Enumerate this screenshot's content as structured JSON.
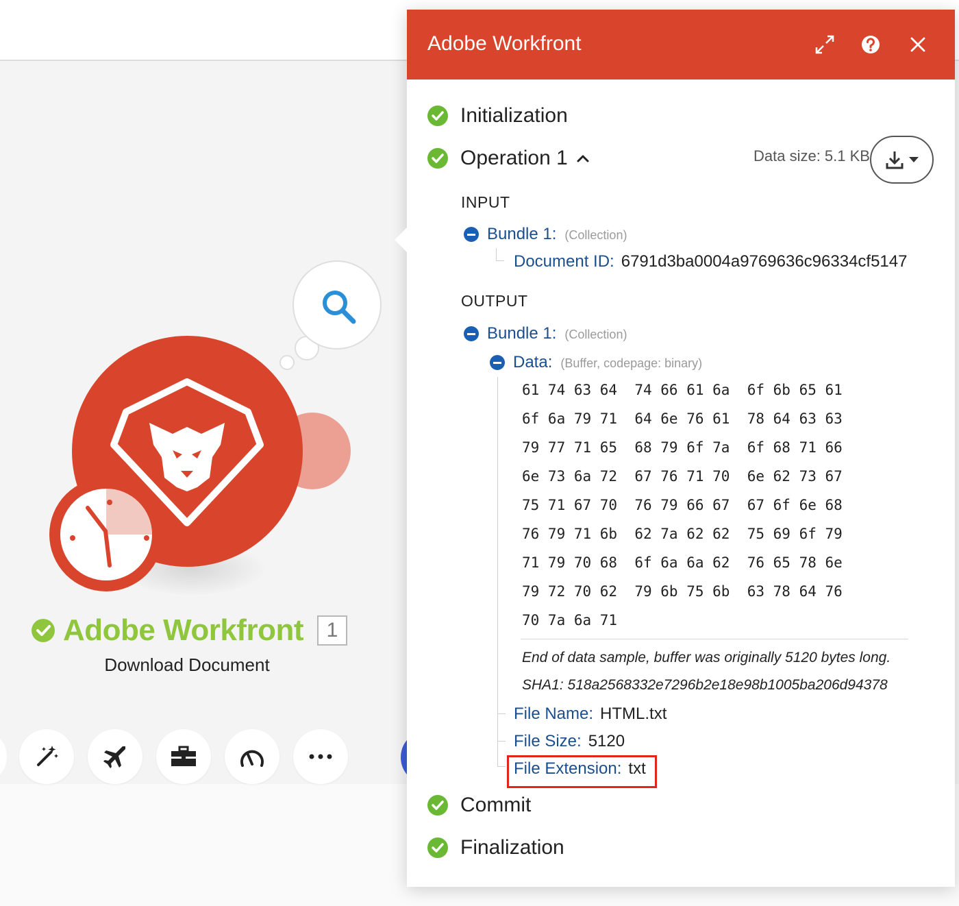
{
  "module": {
    "title": "Adobe Workfront",
    "subtitle": "Download Document",
    "badge": "1"
  },
  "toolbar": {
    "buttons": [
      {
        "name": "magic-wand-icon",
        "glyph": "✨"
      },
      {
        "name": "airplane-icon",
        "glyph": "✈"
      },
      {
        "name": "toolbox-icon",
        "glyph": "🧰"
      },
      {
        "name": "gauge-icon",
        "glyph": "◠"
      },
      {
        "name": "more-icon",
        "glyph": "•••"
      }
    ]
  },
  "panel": {
    "title": "Adobe Workfront",
    "stages": {
      "initialization": "Initialization",
      "operation": "Operation 1",
      "commit": "Commit",
      "finalization": "Finalization"
    },
    "data_size": "Data size: 5.1 KB",
    "input": {
      "heading": "INPUT",
      "bundle_label": "Bundle 1:",
      "bundle_type": "(Collection)",
      "fields": [
        {
          "key": "Document ID:",
          "value": "6791d3ba0004a9769636c96334cf5147"
        }
      ]
    },
    "output": {
      "heading": "OUTPUT",
      "bundle_label": "Bundle 1:",
      "bundle_type": "(Collection)",
      "data_label": "Data:",
      "data_type": "(Buffer, codepage: binary)",
      "hex_lines": [
        "61 74 63 64  74 66 61 6a  6f 6b 65 61",
        "6f 6a 79 71  64 6e 76 61  78 64 63 63",
        "79 77 71 65  68 79 6f 7a  6f 68 71 66",
        "6e 73 6a 72  67 76 71 70  6e 62 73 67",
        "75 71 67 70  76 79 66 67  67 6f 6e 68",
        "76 79 71 6b  62 7a 62 62  75 69 6f 79",
        "71 79 70 68  6f 6a 6a 62  76 65 78 6e",
        "79 72 70 62  79 6b 75 6b  63 78 64 76",
        "70 7a 6a 71"
      ],
      "note_end": "End of data sample, buffer was originally 5120 bytes long.",
      "note_sha": "SHA1: 518a2568332e7296b2e18e98b1005ba206d94378",
      "fields": [
        {
          "key": "File Name:",
          "value": "HTML.txt"
        },
        {
          "key": "File Size:",
          "value": "5120"
        },
        {
          "key": "File Extension:",
          "value": "txt"
        }
      ]
    }
  },
  "colors": {
    "brand": "#d9452c",
    "success": "#8fc63d",
    "link": "#1a4f8f",
    "highlight": "#e0261b"
  }
}
